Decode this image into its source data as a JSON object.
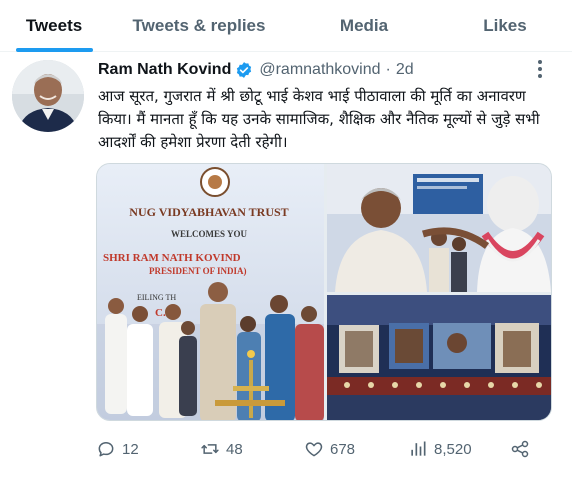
{
  "tabs": [
    {
      "label": "Tweets",
      "active": true
    },
    {
      "label": "Tweets & replies",
      "active": false
    },
    {
      "label": "Media",
      "active": false
    },
    {
      "label": "Likes",
      "active": false
    }
  ],
  "tweet": {
    "author_name": "Ram Nath Kovind",
    "handle": "@ramnathkovind",
    "separator": "·",
    "time": "2d",
    "verified": true,
    "text": "आज सूरत, गुजरात में श्री छोटू भाई केशव भाई पीठावाला की मूर्ति का अनावरण किया। मैं मानता हूँ कि यह उनके सामाजिक, शैक्षिक और नैतिक मूल्यों से जुड़े सभी आदर्शों की हमेशा प्रेरणा देती रहेगी।",
    "media": {
      "left_banner": {
        "line1": "NUG VIDYABHAVAN TRUST",
        "line2": "WELCOMES YOU",
        "line3": "SHRI RAM NATH KOVIND",
        "line4": "PRESIDENT OF INDIA)",
        "line5": "EILING TH",
        "line6": "C. K."
      }
    },
    "stats": {
      "replies": "12",
      "retweets": "48",
      "likes": "678",
      "views": "8,520"
    }
  },
  "colors": {
    "accent": "#1d9bf0",
    "text_primary": "#0f1419",
    "text_secondary": "#536471"
  },
  "icons": [
    "verified-badge-icon",
    "more-icon",
    "reply-icon",
    "retweet-icon",
    "like-icon",
    "views-icon",
    "share-icon"
  ]
}
